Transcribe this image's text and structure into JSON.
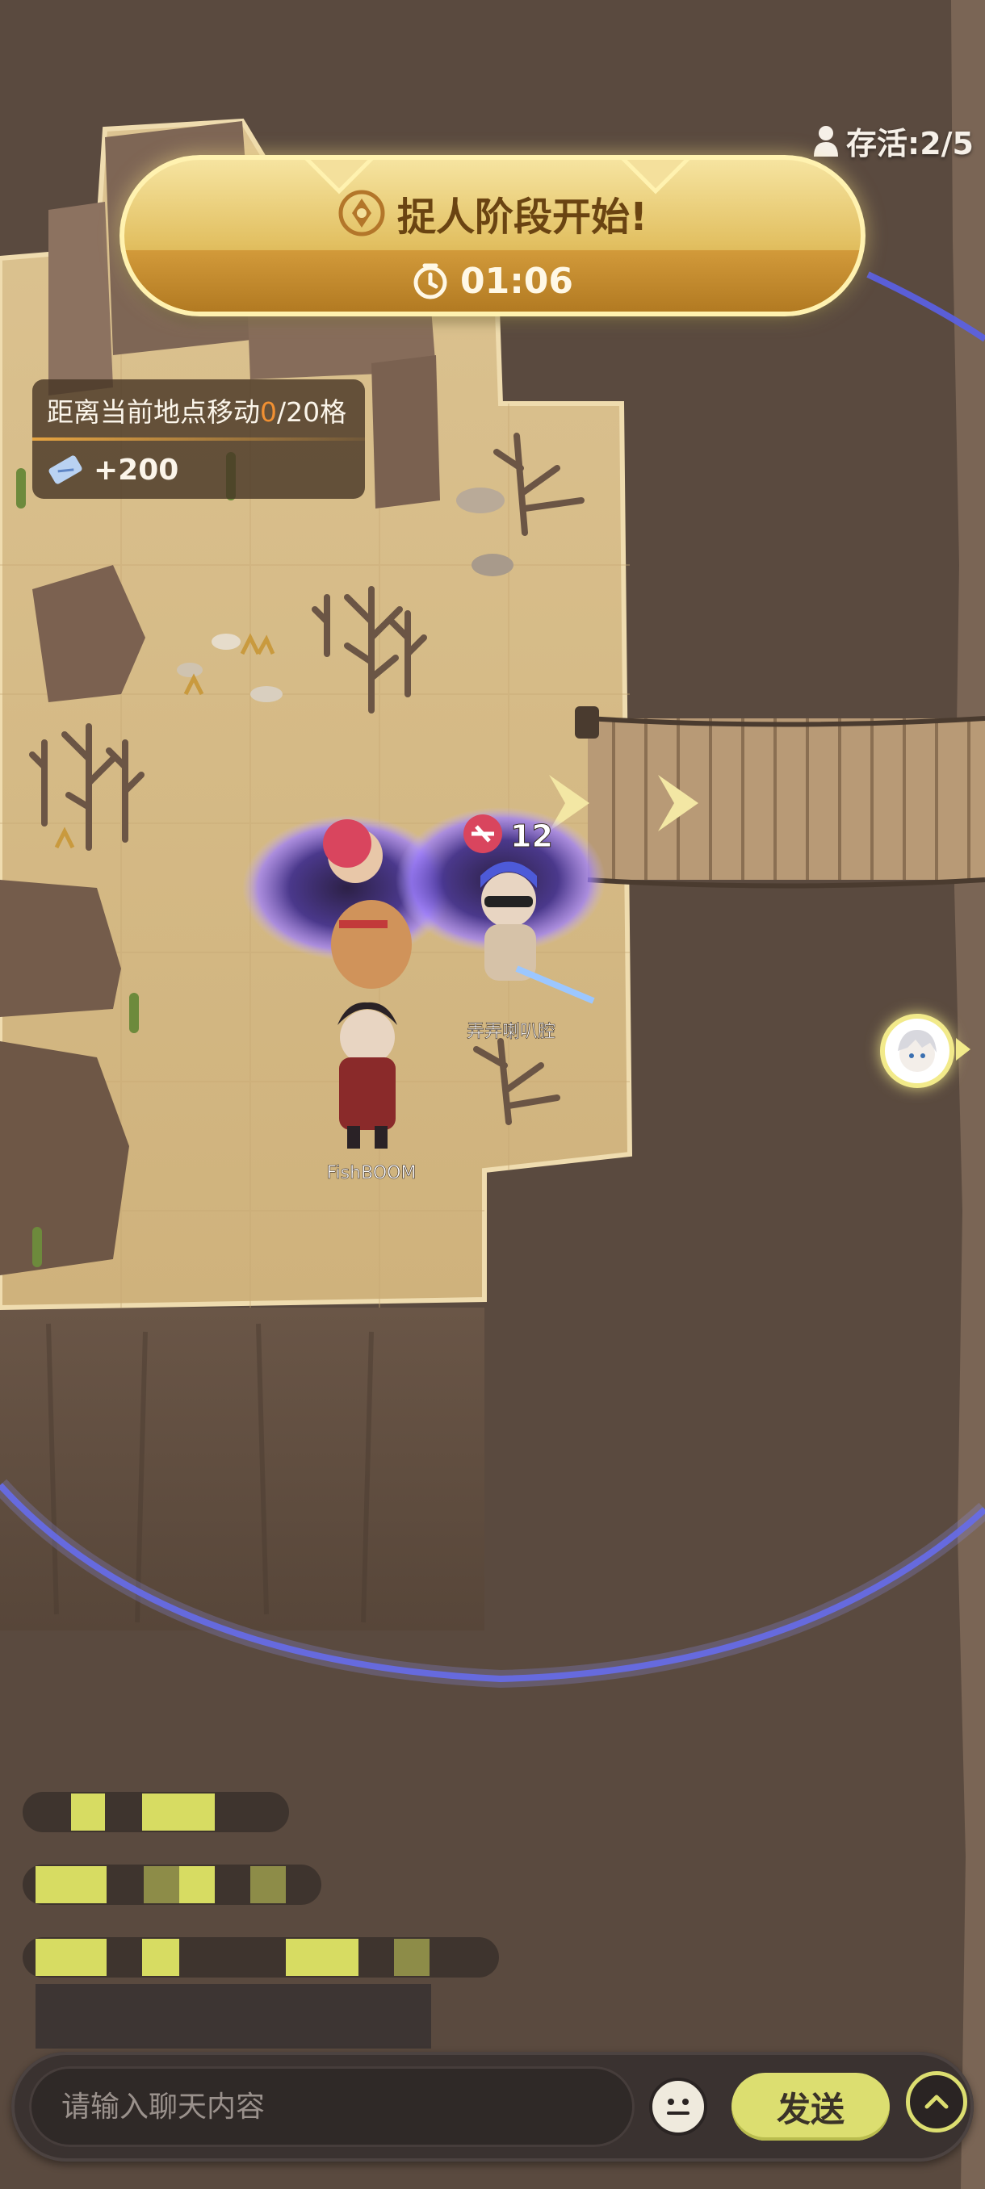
{
  "hud": {
    "survivors_label": "存活:2/5"
  },
  "phase_banner": {
    "title": "捉人阶段开始!",
    "timer": "01:06"
  },
  "quest": {
    "title_prefix": "距离当前地点移动",
    "progress_current": "0",
    "progress_total": "/20格",
    "reward": "+200"
  },
  "players": [
    {
      "name": "FishBOOM"
    },
    {
      "name": "弄弄喇叭腔"
    }
  ],
  "catcher_marker": {
    "count": "12"
  },
  "chat": {
    "input_placeholder": "请输入聊天内容",
    "send_label": "发送"
  },
  "colors": {
    "banner_gold": "#e2c062",
    "quest_highlight": "#f19032",
    "send_button": "#dcde70",
    "boundary_ring": "#5a60e8",
    "ground": "#d7bd88",
    "chasm": "#5a4a3f"
  },
  "icons": {
    "survivors": "person-icon",
    "phase": "compass-diamond-icon",
    "timer": "clock-icon",
    "reward": "ticket-icon",
    "emoji": "smiley-icon",
    "expand": "chevron-up-icon"
  }
}
